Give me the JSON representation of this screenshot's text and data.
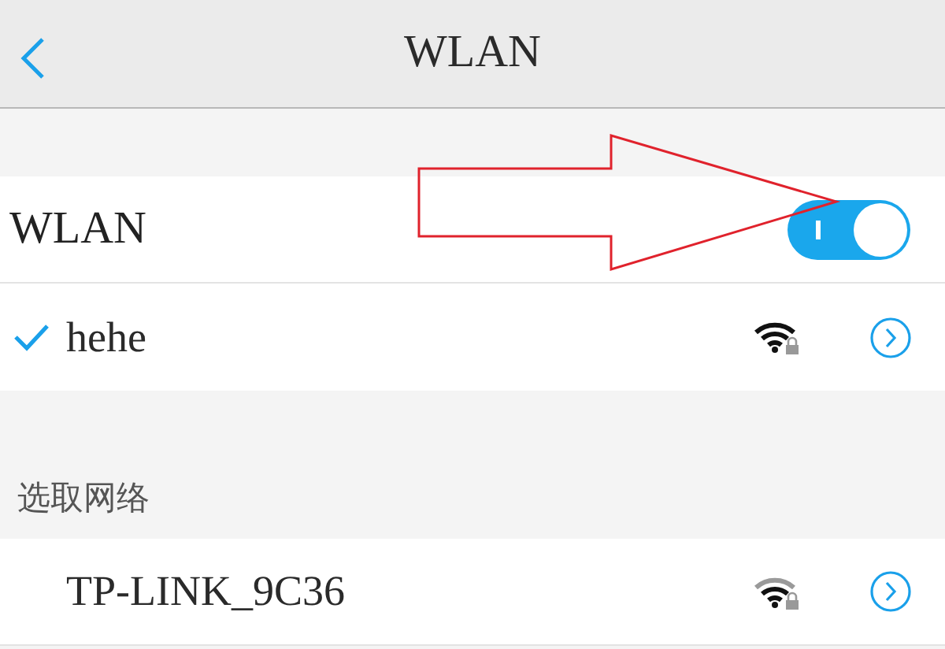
{
  "nav_bar": {
    "title": "WLAN"
  },
  "wlan_switch": {
    "label": "WLAN",
    "on": true
  },
  "current_networks": [
    {
      "name": "hehe",
      "selected": true,
      "full_signal": true
    }
  ],
  "section_header": "选取网络",
  "networks": [
    {
      "name": "TP-LINK_9C36",
      "selected": false,
      "full_signal": false
    }
  ]
}
